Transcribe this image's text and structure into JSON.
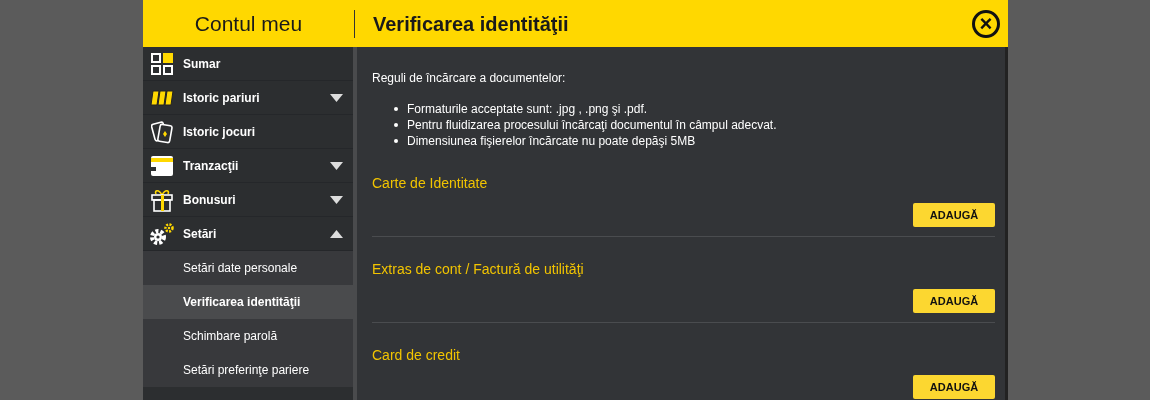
{
  "header": {
    "account_title": "Contul meu",
    "page_title": "Verificarea identităţii",
    "close": "×"
  },
  "sidebar": {
    "items": [
      {
        "label": "Sumar"
      },
      {
        "label": "Istoric pariuri",
        "expanded": false
      },
      {
        "label": "Istoric jocuri"
      },
      {
        "label": "Tranzacţii",
        "expanded": false
      },
      {
        "label": "Bonusuri",
        "expanded": false
      },
      {
        "label": "Setări",
        "expanded": true,
        "children": [
          {
            "label": "Setări date personale",
            "selected": false
          },
          {
            "label": "Verificarea identităţii",
            "selected": true
          },
          {
            "label": "Schimbare parolă",
            "selected": false
          },
          {
            "label": "Setări preferinţe pariere",
            "selected": false
          }
        ]
      }
    ]
  },
  "rules": {
    "intro": "Reguli de încărcare a documentelor:",
    "bullets": [
      "Formaturile acceptate sunt: .jpg , .png şi .pdf.",
      "Pentru fluidizarea procesului încărcaţi documentul în câmpul adecvat.",
      "Dimensiunea fişierelor încărcate nu poate depăşi 5MB"
    ]
  },
  "documents": [
    {
      "title": "Carte de Identitate",
      "button": "ADAUGĂ"
    },
    {
      "title": "Extras de cont / Factură de utilităţi",
      "button": "ADAUGĂ"
    },
    {
      "title": "Card de credit",
      "button": "ADAUGĂ"
    }
  ]
}
